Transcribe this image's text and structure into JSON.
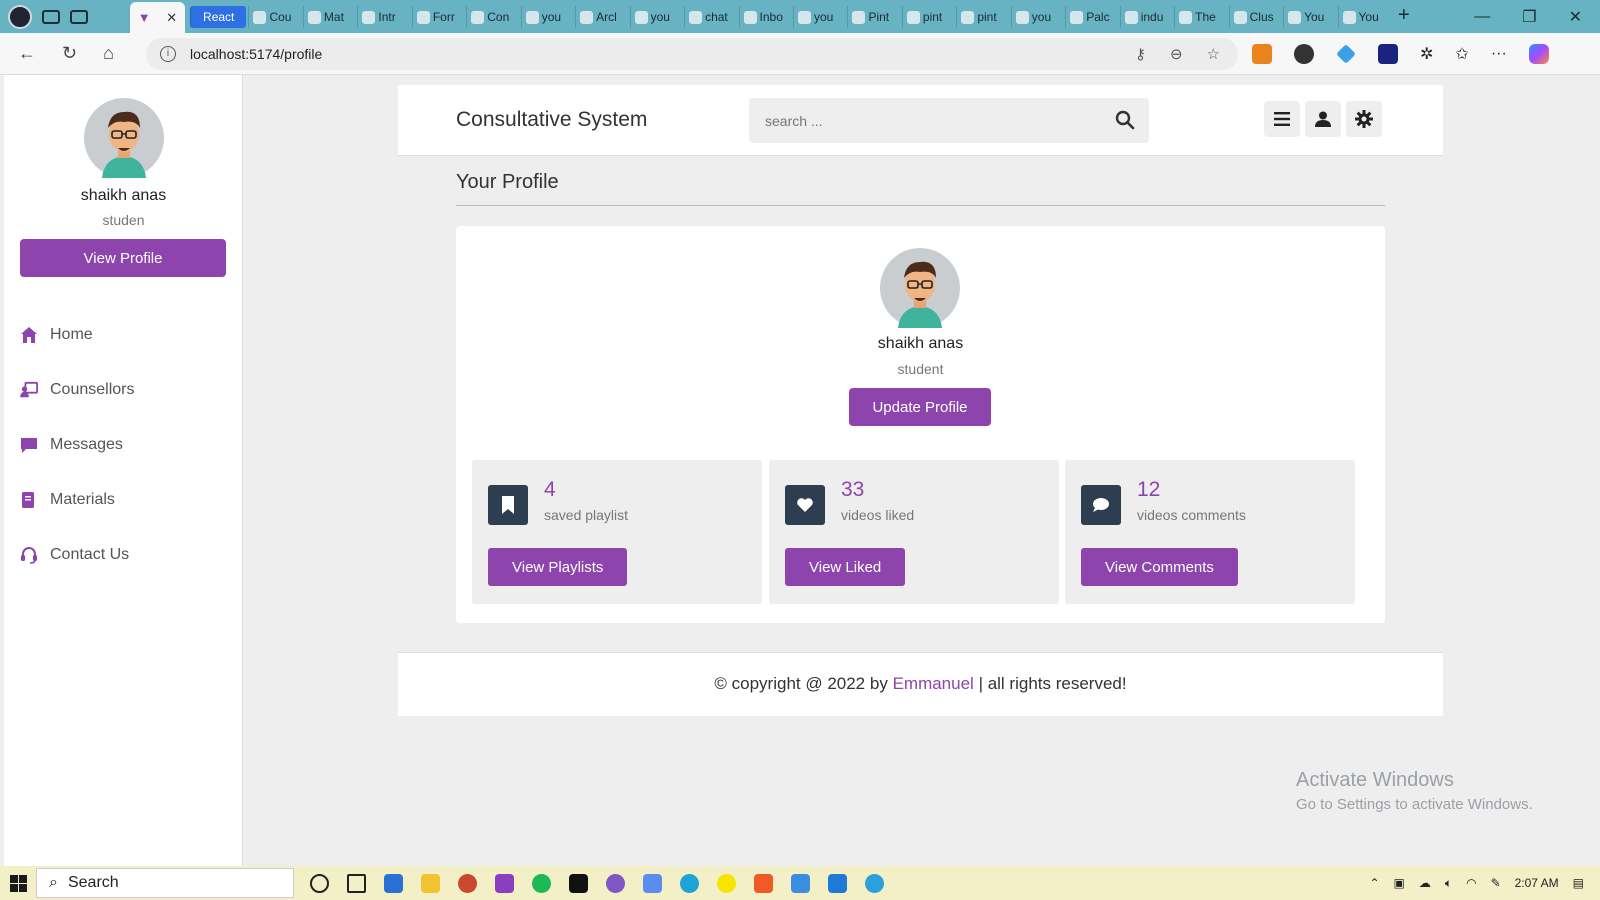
{
  "browser": {
    "active_tab_close": "✕",
    "tabs": [
      {
        "label": "React",
        "highlight": true
      },
      {
        "label": "Cou"
      },
      {
        "label": "Mat"
      },
      {
        "label": "Intr"
      },
      {
        "label": "Forr"
      },
      {
        "label": "Con"
      },
      {
        "label": "you"
      },
      {
        "label": "Arcl"
      },
      {
        "label": "you"
      },
      {
        "label": "chat"
      },
      {
        "label": "Inbo"
      },
      {
        "label": "you"
      },
      {
        "label": "Pint"
      },
      {
        "label": "pint"
      },
      {
        "label": "pint"
      },
      {
        "label": "you"
      },
      {
        "label": "Palc"
      },
      {
        "label": "indu"
      },
      {
        "label": "The"
      },
      {
        "label": "Clus"
      },
      {
        "label": "You"
      },
      {
        "label": "You"
      }
    ],
    "url": "localhost:5174/profile"
  },
  "sidebar": {
    "name": "shaikh anas",
    "role": "studen",
    "view_profile_label": "View Profile",
    "nav": [
      {
        "label": "Home",
        "icon": "home-icon"
      },
      {
        "label": "Counsellors",
        "icon": "chalkboard-teacher-icon"
      },
      {
        "label": "Messages",
        "icon": "message-icon"
      },
      {
        "label": "Materials",
        "icon": "book-icon"
      },
      {
        "label": "Contact Us",
        "icon": "headset-icon"
      }
    ]
  },
  "header": {
    "brand": "Consultative System",
    "search_placeholder": "search ..."
  },
  "main": {
    "heading": "Your Profile",
    "profile": {
      "name": "shaikh anas",
      "role": "student",
      "update_label": "Update Profile"
    },
    "stats": [
      {
        "value": "4",
        "label": "saved playlist",
        "button": "View Playlists",
        "icon": "bookmark-icon"
      },
      {
        "value": "33",
        "label": "videos liked",
        "button": "View Liked",
        "icon": "heart-icon"
      },
      {
        "value": "12",
        "label": "videos comments",
        "button": "View Comments",
        "icon": "comment-icon"
      }
    ]
  },
  "footer": {
    "prefix": "© copyright @ 2022 by",
    "author": "Emmanuel",
    "suffix": "| all rights reserved!"
  },
  "watermark": {
    "line1": "Activate Windows",
    "line2": "Go to Settings to activate Windows."
  },
  "taskbar": {
    "search_label": "Search",
    "time": "2:07 AM"
  },
  "colors": {
    "accent": "#8e44ad",
    "icon_square": "#2c3e50",
    "tab_bar": "#67b3c4",
    "taskbar": "#f3f0c8"
  }
}
